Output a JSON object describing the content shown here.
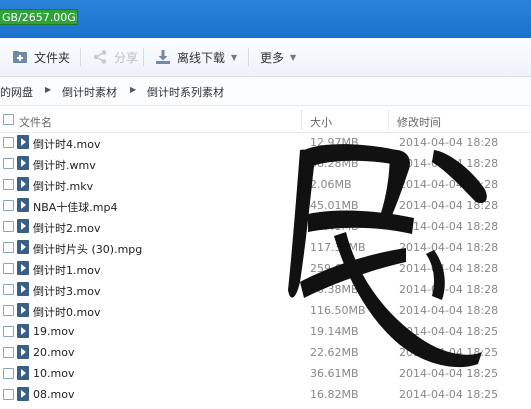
{
  "quota": {
    "text": "GB/2657.00GB"
  },
  "toolbar": {
    "add_folder": "文件夹",
    "share": "分享",
    "offline_download": "离线下载",
    "more": "更多"
  },
  "breadcrumb": [
    "的网盘",
    "倒计时素材",
    "倒计时系列素材"
  ],
  "header": {
    "name": "文件名",
    "size": "大小",
    "modified": "修改时间"
  },
  "files": [
    {
      "name": "倒计时4.mov",
      "size": "12.97MB",
      "date": "2014-04-04 18:28"
    },
    {
      "name": "倒计时.wmv",
      "size": "38.28MB",
      "date": "2014-04-04 18:28"
    },
    {
      "name": "倒计时.mkv",
      "size": "2.06MB",
      "date": "2014-04-04 18:28"
    },
    {
      "name": "NBA十佳球.mp4",
      "size": "45.01MB",
      "date": "2014-04-04 18:28"
    },
    {
      "name": "倒计时2.mov",
      "size": "26.41MB",
      "date": "2014-04-04 18:28"
    },
    {
      "name": "倒计时片头 (30).mpg",
      "size": "117.32MB",
      "date": "2014-04-04 18:28"
    },
    {
      "name": "倒计时1.mov",
      "size": "259.61MB",
      "date": "2014-04-04 18:28"
    },
    {
      "name": "倒计时3.mov",
      "size": "70.38MB",
      "date": "2014-04-04 18:28"
    },
    {
      "name": "倒计时0.mov",
      "size": "116.50MB",
      "date": "2014-04-04 18:28"
    },
    {
      "name": "19.mov",
      "size": "19.14MB",
      "date": "2014-04-04 18:25"
    },
    {
      "name": "20.mov",
      "size": "22.62MB",
      "date": "2014-04-04 18:25"
    },
    {
      "name": "10.mov",
      "size": "36.61MB",
      "date": "2014-04-04 18:25"
    },
    {
      "name": "08.mov",
      "size": "16.82MB",
      "date": "2014-04-04 18:25"
    }
  ]
}
